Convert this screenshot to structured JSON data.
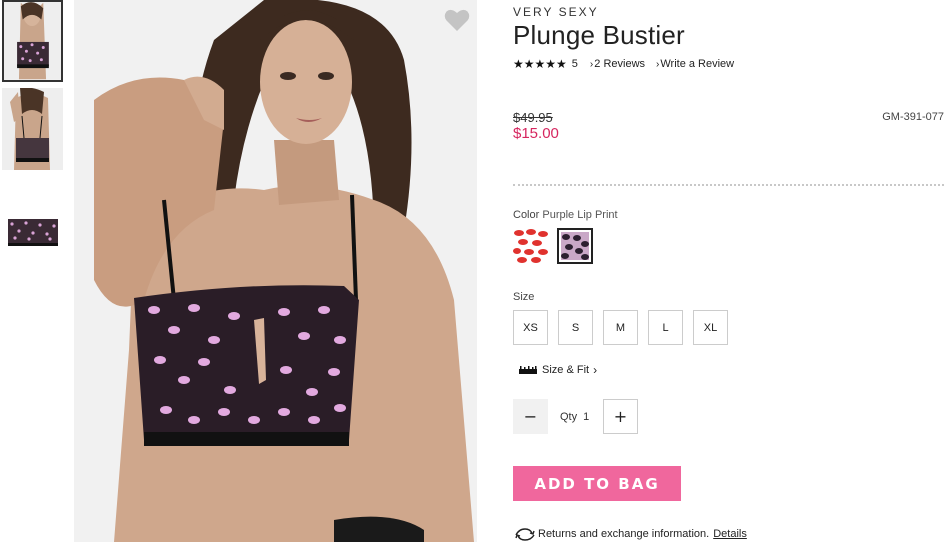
{
  "thumbnails": [
    {
      "alt": "front"
    },
    {
      "alt": "back"
    },
    {
      "alt": "flat"
    }
  ],
  "product": {
    "brand": "VERY SEXY",
    "title": "Plunge Bustier",
    "stars": "★★★★★",
    "rating": "5",
    "reviews": "2 Reviews",
    "write_review": "Write a Review",
    "old_price": "$49.95",
    "new_price": "$15.00",
    "sku": "GM-391-077"
  },
  "color": {
    "label": "Color",
    "value": "Purple Lip Print",
    "swatches": [
      {
        "name": "Red Lip Print",
        "color": "#e0322e"
      },
      {
        "name": "Purple Lip Print",
        "color": "#8a6f8a"
      }
    ]
  },
  "size": {
    "label": "Size",
    "options": [
      "XS",
      "S",
      "M",
      "L",
      "XL"
    ],
    "fit_link": "Size & Fit"
  },
  "quantity": {
    "minus": "−",
    "label": "Qty",
    "value": "1",
    "plus": "+"
  },
  "add_to_bag": "ADD TO BAG",
  "returns": {
    "text": "Returns and exchange information.",
    "link": "Details"
  },
  "colors": {
    "sale": "#d6265f",
    "cta": "#f0679d"
  }
}
